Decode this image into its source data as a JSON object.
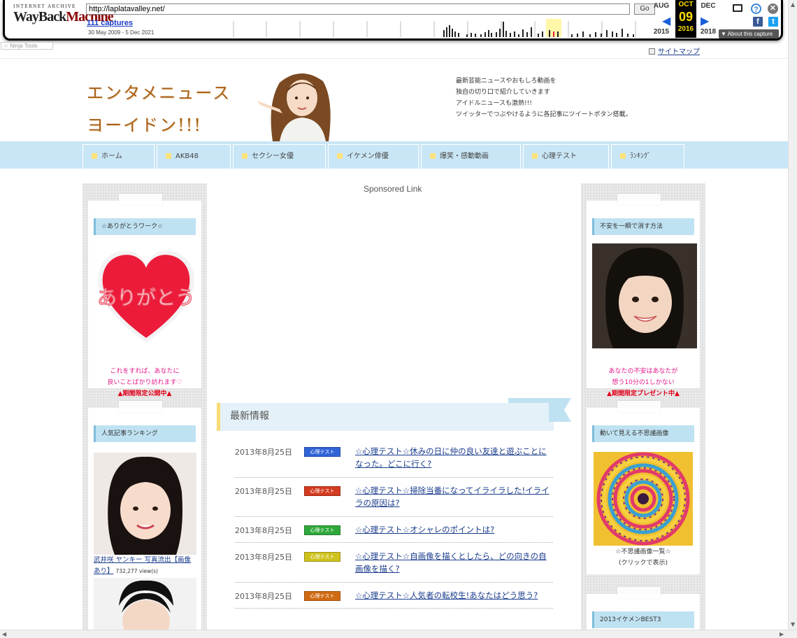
{
  "wayback": {
    "logo_small": "INTERNET ARCHIVE",
    "logo_big_a": "WayBack",
    "logo_big_b": "Machine",
    "url": "http://laplatavalley.net/",
    "go_label": "Go",
    "captures": "111 captures",
    "date_range": "30 May 2009 - 5 Dec 2021",
    "prev_month": "AUG",
    "cur_month": "OCT",
    "next_month": "DEC",
    "cur_day": "09",
    "prev_year": "2015",
    "cur_year": "2016",
    "next_year": "2018",
    "about": "About this capture"
  },
  "ninja_tools": "Ninja Tools",
  "sitemap_label": "サイトマップ",
  "header": {
    "title_line1": "エンタメニュース",
    "title_line2": "ヨーイドン!!!",
    "desc": [
      "最新芸能ニュースやおもしろ動画を",
      "独自の切り口で紹介していきます",
      "アイドルニュースも激熱!!!",
      "ツイッターでつぶやけるように各記事にツイートボタン搭載。"
    ]
  },
  "nav": [
    "ホーム",
    "AKB48",
    "セクシー女優",
    "イケメン俳優",
    "爆笑・感動動画",
    "心理テスト",
    "ﾗﾝｷﾝｸﾞ"
  ],
  "left": {
    "w1_title": "☆ありがとうワーク☆",
    "w1_heart": "ありがとう",
    "w1_line1": "これをすれば、あなたに",
    "w1_line2": "良いことばかり訪れます♡",
    "w1_line3": "▲期間限定公開中▲",
    "w2_title": "人気記事ランキング",
    "w2_link": "武井咲 ヤンキー 写真流出【画像あり】",
    "w2_views": "732,277 view(s)"
  },
  "right": {
    "w1_title": "不安を一瞬で消す方法",
    "w1_line1": "あなたの不安はあなたが",
    "w1_line2": "想う10分の1しかない",
    "w1_line3": "▲期間限定プレゼント中▲",
    "w2_title": "動いて見える不思議画像",
    "w2_line1": "☆不思議画像一覧☆",
    "w2_line2": "(クリックで表示)",
    "w3_title": "2013イケメンBEST3"
  },
  "center": {
    "sponsored": "Sponsored Link",
    "news_title": "最新情報",
    "news": [
      {
        "date": "2013年8月25日",
        "badge": "心理テスト",
        "title": "☆心理テスト☆休みの日に仲の良い友達と遊ぶことになった。どこに行く?"
      },
      {
        "date": "2013年8月25日",
        "badge": "心理テスト",
        "title": "☆心理テスト☆掃除当番になってイライラした!イライラの原因は?"
      },
      {
        "date": "2013年8月25日",
        "badge": "心理テスト",
        "title": "☆心理テスト☆オシャレのポイントは?"
      },
      {
        "date": "2013年8月25日",
        "badge": "心理テスト",
        "title": "☆心理テスト☆自画像を描くとしたら、どの向きの自画像を描く?"
      },
      {
        "date": "2013年8月25日",
        "badge": "心理テスト",
        "title": "☆心理テスト☆人気者の転校生!あなたはどう思う?"
      }
    ]
  },
  "colors": {
    "badge_blue": "#2f63d6",
    "badge_red": "#d33b1f",
    "badge_green": "#2ea83a",
    "badge_yellow": "#cfc21e",
    "badge_orange": "#cf6a12",
    "nav_bg": "#c9e6f6"
  }
}
